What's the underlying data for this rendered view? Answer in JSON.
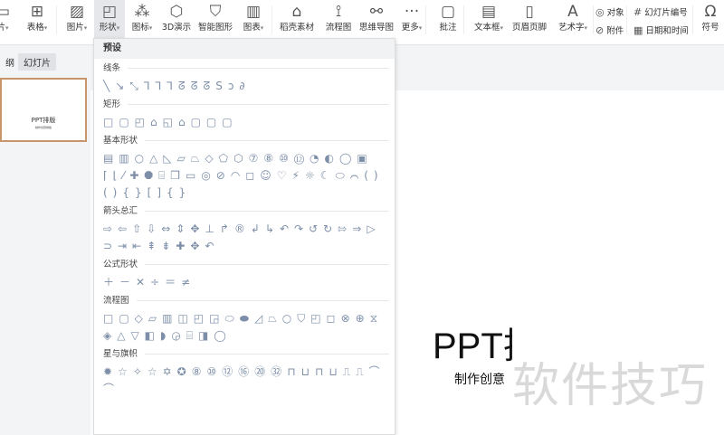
{
  "toolbar": {
    "items": [
      {
        "label": "片",
        "icon": "slide-icon",
        "dropdown": true
      },
      {
        "label": "表格",
        "icon": "table-icon",
        "dropdown": true
      },
      {
        "label": "图片",
        "icon": "picture-icon",
        "dropdown": true
      },
      {
        "label": "形状",
        "icon": "shapes-icon",
        "dropdown": true,
        "active": true
      },
      {
        "label": "图标",
        "icon": "icons-icon",
        "dropdown": true
      },
      {
        "label": "3D演示",
        "icon": "cube-icon"
      },
      {
        "label": "智能图形",
        "icon": "smartart-icon"
      },
      {
        "label": "图表",
        "icon": "chart-icon",
        "dropdown": true
      },
      {
        "label": "稻壳素材",
        "icon": "material-icon"
      },
      {
        "label": "流程图",
        "icon": "flowchart-icon"
      },
      {
        "label": "思维导图",
        "icon": "mindmap-icon"
      },
      {
        "label": "更多",
        "icon": "more-icon",
        "dropdown": true
      },
      {
        "label": "批注",
        "icon": "comment-icon"
      },
      {
        "label": "文本框",
        "icon": "textbox-icon",
        "dropdown": true
      },
      {
        "label": "页眉页脚",
        "icon": "header-footer-icon"
      },
      {
        "label": "艺术字",
        "icon": "wordart-icon",
        "dropdown": true
      },
      {
        "label": "符号",
        "icon": "omega-icon"
      }
    ],
    "small": [
      {
        "label": "对象",
        "icon": "object-icon"
      },
      {
        "label": "附件",
        "icon": "attachment-icon"
      },
      {
        "label": "幻灯片编号",
        "icon": "slide-number-icon"
      },
      {
        "label": "日期和时间",
        "icon": "date-time-icon"
      }
    ],
    "dropdown_arrow": "▾"
  },
  "left_panel": {
    "tab_outline": "纲",
    "tab_slides": "幻灯片",
    "thumb_title": "PPT排版",
    "thumb_subtitle": "制作创意排版"
  },
  "slide": {
    "title": "PPT排版",
    "subtitle": "制作创意",
    "watermark": "软件技巧"
  },
  "shapes_panel": {
    "preset": "预设",
    "sections": [
      {
        "label": "线条",
        "shapes": "╲↘⤡⅂⅂⅂ᘔᘔᘔSↄ∂"
      },
      {
        "label": "矩形",
        "shapes": "□▢◰⌂◱⌂▢▢▢"
      },
      {
        "label": "基本形状",
        "shapes": "▤▥○△◺▱⏢◇⬠⬡⑦⑧⑩⑫◔◐◯▣⌈⌊⁄✚⯃⌸❒▭◎⊘◠◻☺♡⚡☼☾⬭⌒()(){}[]{}"
      },
      {
        "label": "箭头总汇",
        "shapes": "⇨⇦⇧⇩⇔⇕✥⊥↱®↲↳↶↷↺↻⇰⇒▷⊃⇥⇤⇞⇟✚✥↶"
      },
      {
        "label": "公式形状",
        "shapes": "＋－✕÷＝≠"
      },
      {
        "label": "流程图",
        "shapes": "□▢◇▱▥◫◰◲⬭⬬◿⏢○⛉◰◻⊗⊕⧖◈△▽◧◗◶⌸◨◯"
      },
      {
        "label": "星与旗帜",
        "shapes": "✹☆✧☆✡✪⑧⑩⑫⑯⑳㉜⊓⊔⊓⊔⎍⎍⌒⌒"
      }
    ]
  },
  "colors": {
    "accent_border": "#c8956a",
    "shape_stroke": "#7d8fa8",
    "active_tab": "#e6e7ea"
  }
}
